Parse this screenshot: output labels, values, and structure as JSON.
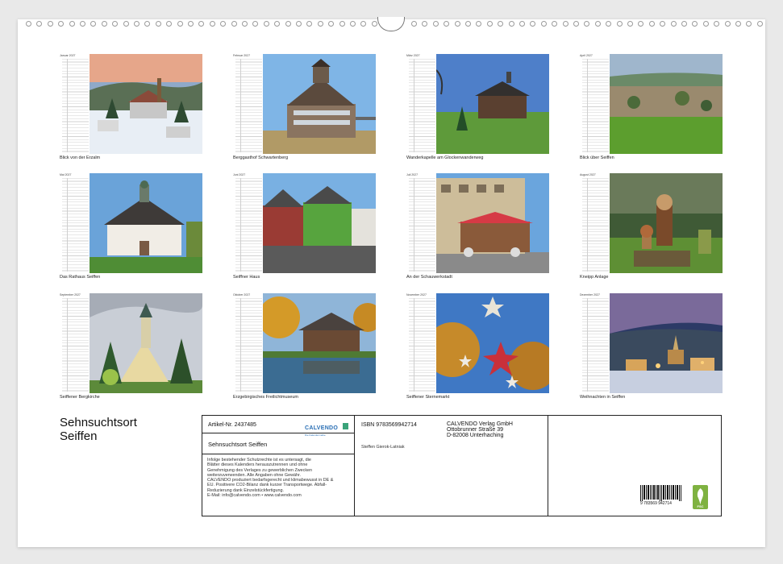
{
  "calendar": {
    "title_line1": "Sehnsuchtsort",
    "title_line2": "Seiffen",
    "months": [
      {
        "name": "Januar 2027",
        "caption": "Blick von der Erzalm"
      },
      {
        "name": "Februar 2027",
        "caption": "Berggasthof Schwartenberg"
      },
      {
        "name": "März 2027",
        "caption": "Wanderkapelle am Glockenwanderweg"
      },
      {
        "name": "April 2027",
        "caption": "Blick über Seiffen"
      },
      {
        "name": "Mai 2027",
        "caption": "Das Rathaus Seiffen"
      },
      {
        "name": "Juni 2027",
        "caption": "Seiffner Haus"
      },
      {
        "name": "Juli 2027",
        "caption": "An der Schauwerkstadt"
      },
      {
        "name": "August 2027",
        "caption": "Kneipp Anlage"
      },
      {
        "name": "September 2027",
        "caption": "Seiffener Bergkirche"
      },
      {
        "name": "Oktober 2027",
        "caption": "Erzgebirgisches Freilichtmuseum"
      },
      {
        "name": "November 2027",
        "caption": "Seiffener Sternemarkt"
      },
      {
        "name": "Dezember 2027",
        "caption": "Weihnachten in Seiffen"
      }
    ]
  },
  "info": {
    "article": "Artikel-Nr. 2437485",
    "logo_text": "CALVENDO",
    "logo_sub": "Die Kalendermarke",
    "product_title": "Sehnsuchtsort Seiffen",
    "legal_lines": [
      "Infolge bestehender Schutzrechte ist es untersagt, die",
      "Blätter dieses Kalenders herauszutrennen und ohne",
      "Genehmigung des Verlages zu gewerblichen Zwecken",
      "weiterzuverwenden. Alle Angaben ohne Gewähr.",
      "CALVENDO produziert bedarfsgerecht und klimabewusst in DE &",
      "EU. Positivere CO2-Bilanz dank kurzer Transportwege. Abfall-",
      "Reduzierung dank Einzelstückfertigung.",
      "E-Mail: info@calvendo.com • www.calvendo.com"
    ],
    "isbn": "ISBN 9783569942714",
    "author": "Steffen Gierok-Latniak",
    "publisher_lines": [
      "CALVENDO Verlag GmbH",
      "Ottobrunner Straße 39",
      "D-82008 Unterhaching"
    ],
    "barcode_number": "9 783569 942714",
    "fsc_label": "FSC"
  },
  "colors": {
    "accent": "#2a6fb5",
    "fsc": "#7fb241"
  }
}
